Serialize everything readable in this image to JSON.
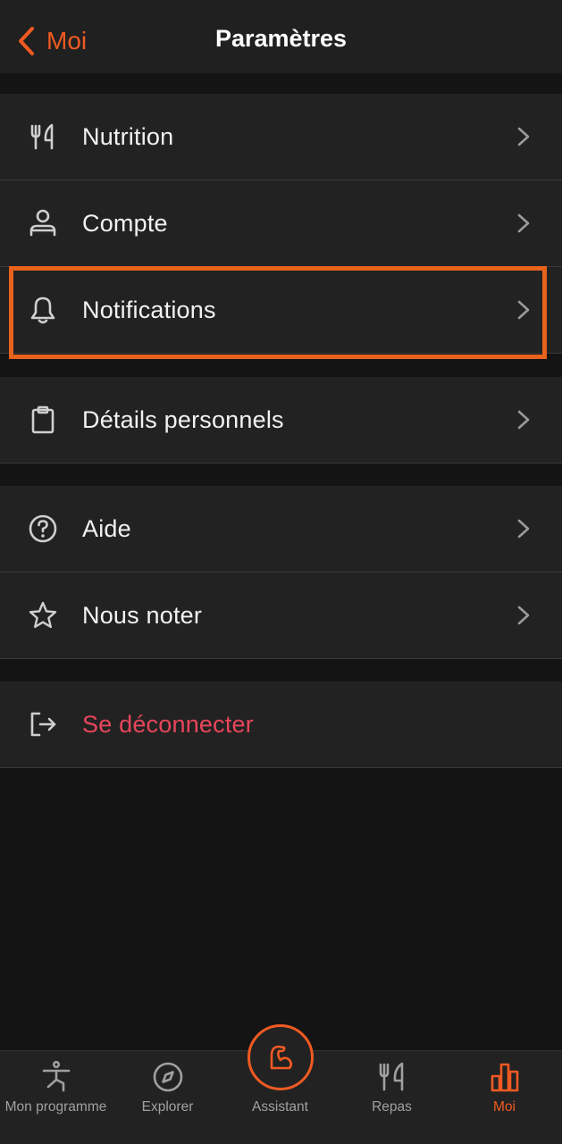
{
  "header": {
    "back_label": "Moi",
    "title": "Paramètres"
  },
  "groups": [
    {
      "items": [
        {
          "label": "Nutrition",
          "icon": "fork-knife-icon"
        },
        {
          "label": "Compte",
          "icon": "person-icon"
        },
        {
          "label": "Notifications",
          "icon": "bell-icon"
        }
      ]
    },
    {
      "items": [
        {
          "label": "Détails personnels",
          "icon": "clipboard-icon"
        }
      ]
    },
    {
      "items": [
        {
          "label": "Aide",
          "icon": "help-circle-icon"
        },
        {
          "label": "Nous noter",
          "icon": "star-icon"
        }
      ]
    },
    {
      "items": [
        {
          "label": "Se déconnecter",
          "icon": "logout-icon"
        }
      ]
    }
  ],
  "tabbar": {
    "tabs": [
      {
        "label": "Mon programme",
        "icon": "yoga-person-icon"
      },
      {
        "label": "Explorer",
        "icon": "compass-icon"
      },
      {
        "label": "Assistant",
        "icon": "muscle-arm-icon"
      },
      {
        "label": "Repas",
        "icon": "fork-knife-icon"
      },
      {
        "label": "Moi",
        "icon": "bar-chart-icon"
      }
    ],
    "active": "Moi"
  },
  "colors": {
    "accent": "#f05a22",
    "danger": "#e8455a",
    "background": "#141414",
    "surface": "#222222"
  }
}
